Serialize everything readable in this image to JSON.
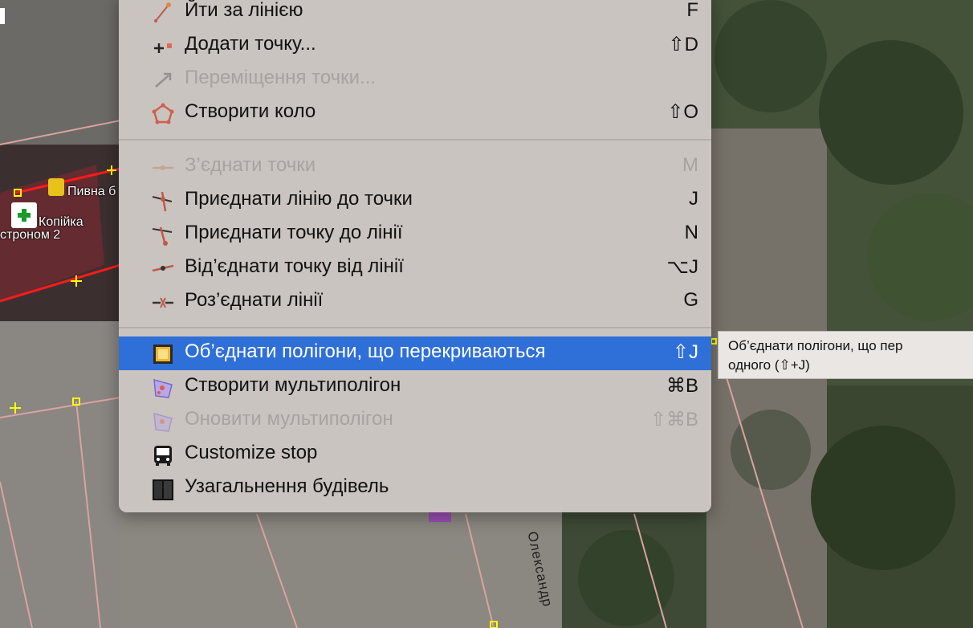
{
  "map": {
    "labels": {
      "pivna": "Пивна б",
      "kopiyka": "Копійка",
      "hastronom": "стронoм 2",
      "street": "Олександр"
    }
  },
  "menu": {
    "items": [
      {
        "label": "Йти за лінією",
        "shortcut": "F",
        "icon": "follow-line-icon",
        "enabled": true
      },
      {
        "label": "Додати точку...",
        "shortcut": "⇧D",
        "icon": "add-node-icon",
        "enabled": true
      },
      {
        "label": "Переміщення точки...",
        "shortcut": "",
        "icon": "move-node-icon",
        "enabled": false
      },
      {
        "label": "Створити коло",
        "shortcut": "⇧O",
        "icon": "create-circle-icon",
        "enabled": true
      },
      {
        "label": "З’єднати точки",
        "shortcut": "M",
        "icon": "merge-nodes-icon",
        "enabled": false
      },
      {
        "label": "Приєднати лінію до точки",
        "shortcut": "J",
        "icon": "join-way-to-node-icon",
        "enabled": true
      },
      {
        "label": "Приєднати точку до лінії",
        "shortcut": "N",
        "icon": "join-node-to-way-icon",
        "enabled": true
      },
      {
        "label": "Від’єднати точку від лінії",
        "shortcut": "⌥J",
        "icon": "disconnect-node-icon",
        "enabled": true
      },
      {
        "label": "Роз’єднати лінії",
        "shortcut": "G",
        "icon": "split-ways-icon",
        "enabled": true
      },
      {
        "label": "Об’єднати полігони, що перекриваються",
        "shortcut": "⇧J",
        "icon": "join-polygons-icon",
        "enabled": true,
        "selected": true
      },
      {
        "label": "Створити мультиполігон",
        "shortcut": "⌘B",
        "icon": "create-multipolygon-icon",
        "enabled": true
      },
      {
        "label": "Оновити мультиполігон",
        "shortcut": "⇧⌘B",
        "icon": "update-multipolygon-icon",
        "enabled": false
      },
      {
        "label": "Customize stop",
        "shortcut": "",
        "icon": "bus-stop-icon",
        "enabled": true
      },
      {
        "label": "Узагальнення будівель",
        "shortcut": "",
        "icon": "building-generalization-icon",
        "enabled": true
      }
    ]
  },
  "tooltip": {
    "line1": "Об’єднати полігони, що пер",
    "line2": "одного (⇧+J)"
  },
  "colors": {
    "selection": "#2f6fd8",
    "menu_bg": "#cec8c4",
    "disabled_text": "#a8a2a0"
  }
}
